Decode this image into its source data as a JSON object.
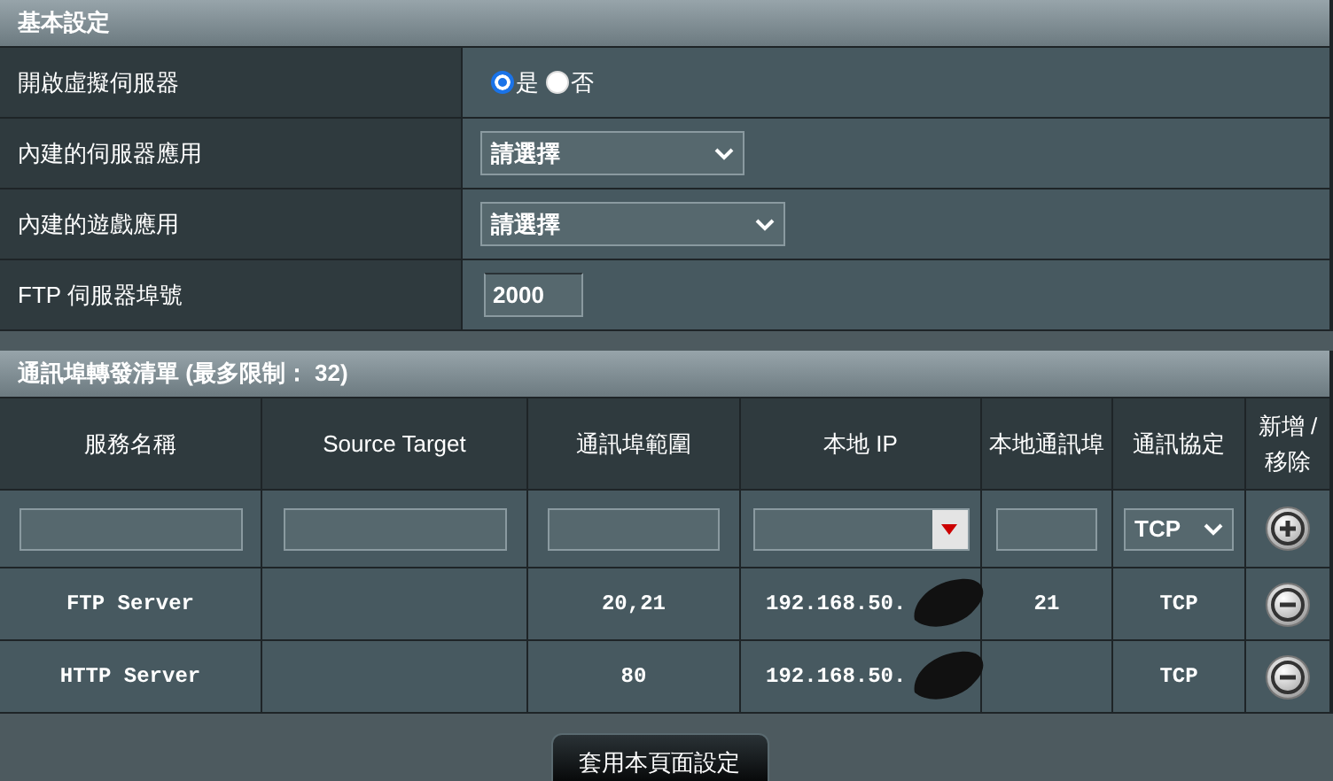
{
  "basic_settings": {
    "title": "基本設定",
    "rows": [
      {
        "kind": "radio",
        "label": "開啟虛擬伺服器",
        "options": [
          {
            "label": "是",
            "selected": true
          },
          {
            "label": "否",
            "selected": false
          }
        ]
      },
      {
        "kind": "select",
        "label": "內建的伺服器應用",
        "value": "請選擇",
        "wide": false
      },
      {
        "kind": "select",
        "label": "內建的遊戲應用",
        "value": "請選擇",
        "wide": true
      },
      {
        "kind": "input",
        "label": "FTP 伺服器埠號",
        "value": "2000"
      }
    ]
  },
  "port_forwarding_list": {
    "title": "通訊埠轉發清單 (最多限制： 32)",
    "columns": [
      "服務名稱",
      "Source Target",
      "通訊埠範圍",
      "本地 IP",
      "本地通訊埠",
      "通訊協定",
      "新增 / 移除"
    ],
    "new_entry": {
      "protocol": "TCP"
    },
    "rows": [
      {
        "service_name": "FTP Server",
        "port_range": "20,21",
        "local_ip": "192.168.50.",
        "local_port": "21",
        "protocol": "TCP"
      },
      {
        "service_name": "HTTP Server",
        "port_range": "80",
        "local_ip": "192.168.50.",
        "protocol": "TCP"
      }
    ]
  },
  "apply_button": "套用本頁面設定"
}
